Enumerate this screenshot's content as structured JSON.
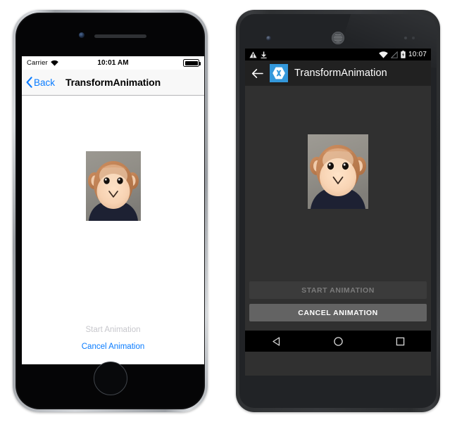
{
  "scene": {
    "background": "#ffffff",
    "description": "Side-by-side iOS and Android phone mockups of a TransformAnimation sample page"
  },
  "ios": {
    "device_frame": "iphone-silver",
    "status_bar": {
      "carrier": "Carrier",
      "wifi_icon": "wifi-icon",
      "time": "10:01 AM",
      "battery_icon": "battery-full-icon"
    },
    "nav_bar": {
      "back_icon": "chevron-left-icon",
      "back_label": "Back",
      "title": "TransformAnimation",
      "tint_color": "#0a7cff"
    },
    "content": {
      "image_name": "monkey-photo",
      "image_alt": "Plush monkey toy face"
    },
    "buttons": [
      {
        "label": "Start Animation",
        "state": "disabled",
        "color": "#c7c7cc"
      },
      {
        "label": "Cancel Animation",
        "state": "enabled",
        "color": "#0a7cff"
      }
    ],
    "hardware": {
      "camera_icon": "front-camera-icon",
      "speaker_icon": "earpiece-speaker-icon",
      "home_button_icon": "home-button-icon"
    }
  },
  "android": {
    "device_frame": "nexus-dark-grey",
    "status_bar": {
      "warning_icon": "warning-triangle-icon",
      "download_icon": "download-arrow-icon",
      "wifi_icon": "wifi-icon",
      "signal_icon": "no-signal-icon",
      "battery_icon": "battery-charging-icon",
      "time": "10:07",
      "background": "#000000"
    },
    "toolbar": {
      "back_icon": "arrow-left-icon",
      "app_icon": "xamarin-logo-icon",
      "app_icon_letter": "X",
      "app_icon_color": "#3498db",
      "title": "TransformAnimation",
      "background": "#212121"
    },
    "content": {
      "background": "#303030",
      "image_name": "monkey-photo",
      "image_alt": "Plush monkey toy face"
    },
    "buttons": [
      {
        "label": "START ANIMATION",
        "state": "disabled",
        "background": "#3b3b3b",
        "color": "#7b7b7b"
      },
      {
        "label": "CANCEL ANIMATION",
        "state": "enabled",
        "background": "#636363",
        "color": "#ffffff"
      }
    ],
    "nav_bar": {
      "background": "#000000",
      "keys": [
        {
          "name": "back-key",
          "icon": "triangle-left-icon"
        },
        {
          "name": "home-key",
          "icon": "circle-icon"
        },
        {
          "name": "recents-key",
          "icon": "square-icon"
        }
      ]
    },
    "hardware": {
      "camera_icon": "front-camera-icon",
      "speaker_icon": "earpiece-speaker-icon",
      "sensor_icon": "proximity-sensor-icon"
    }
  }
}
